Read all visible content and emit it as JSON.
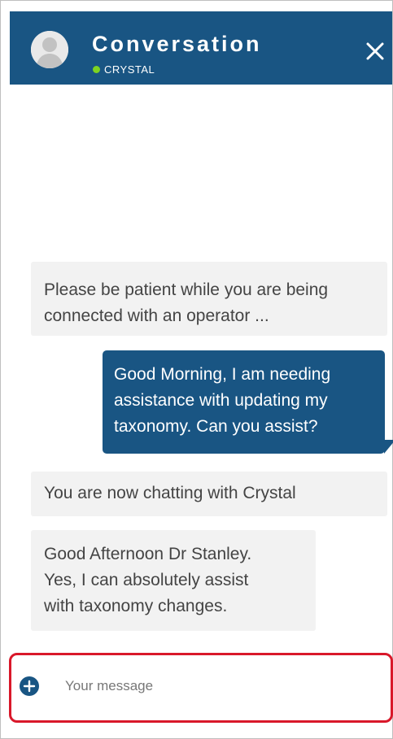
{
  "header": {
    "title": "Conversation",
    "status": "CRYSTAL",
    "status_color": "#7ed321",
    "background": "#195583",
    "avatar_icon": "person-avatar-icon",
    "close_icon": "close-icon"
  },
  "messages": [
    {
      "sender": "agent",
      "lines": [
        "Please be patient while you are being",
        "connected with an operator ..."
      ]
    },
    {
      "sender": "user",
      "lines": [
        "Good Morning, I am needing",
        "assistance with updating my",
        "taxonomy. Can you assist?"
      ]
    },
    {
      "sender": "agent",
      "lines": [
        "You are now chatting with Crystal"
      ]
    },
    {
      "sender": "agent",
      "lines": [
        "Good Afternoon Dr Stanley.",
        "Yes, I can absolutely assist",
        "with taxonomy changes."
      ]
    }
  ],
  "composer": {
    "placeholder": "Your message",
    "value": "",
    "add_icon": "plus-circle-icon",
    "highlight_color": "#d9182a"
  }
}
